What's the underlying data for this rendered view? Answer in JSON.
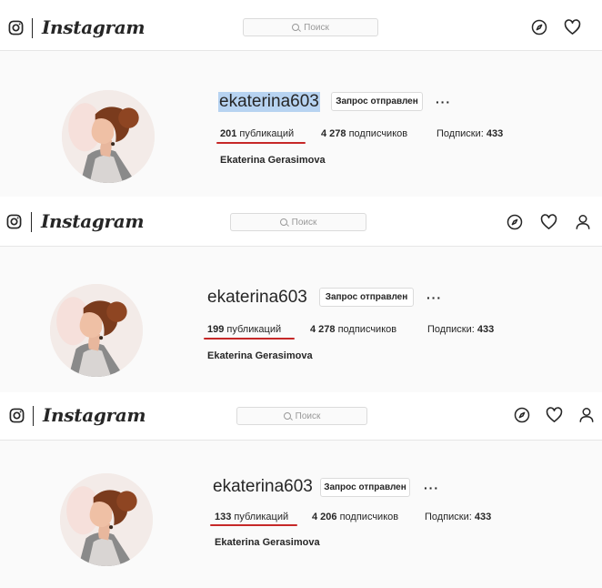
{
  "app": {
    "wordmark": "Instagram",
    "search_placeholder": "Поиск"
  },
  "profile": {
    "full_name": "Ekaterina Gerasimova",
    "request_button": "Запрос отправлен",
    "more_label": "···"
  },
  "snapshots": [
    {
      "username": "ekaterina603",
      "posts_count": "201",
      "posts_label": "публикаций",
      "followers_count": "4 278",
      "followers_label": "подписчиков",
      "following_label": "Подписки:",
      "following_count": "433",
      "username_selected": true
    },
    {
      "username": "ekaterina603",
      "posts_count": "199",
      "posts_label": "публикаций",
      "followers_count": "4 278",
      "followers_label": "подписчиков",
      "following_label": "Подписки:",
      "following_count": "433",
      "username_selected": false
    },
    {
      "username": "ekaterina603",
      "posts_count": "133",
      "posts_label": "публикаций",
      "followers_count": "4 206",
      "followers_label": "подписчиков",
      "following_label": "Подписки:",
      "following_count": "433",
      "username_selected": false
    }
  ],
  "colors": {
    "underline": "#c62828",
    "selection": "#b7d3f1"
  }
}
